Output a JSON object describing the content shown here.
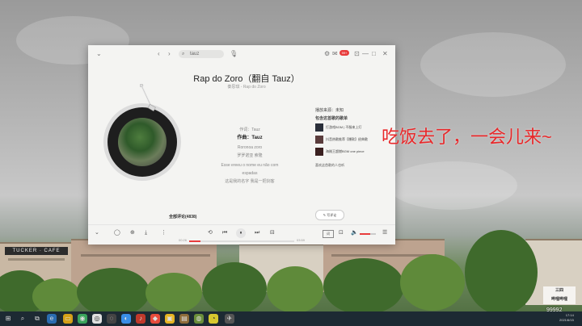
{
  "search": {
    "query": "tauz",
    "icon": "search-icon"
  },
  "topbar": {
    "back": "‹",
    "forward": "›",
    "mic": "🎙",
    "badge": "99+",
    "minimize": "—",
    "maximize": "□",
    "close": "✕",
    "collapse": "⌄"
  },
  "song": {
    "title": "Rap do Zoro（翻自 Tauz）",
    "subtitle": "秦思琪 - Rap do Zoro"
  },
  "lyrics": [
    {
      "text": "作词：Tauz",
      "current": false
    },
    {
      "text": "作曲：Tauz",
      "current": true
    },
    {
      "text": "Roronoa zoro",
      "current": false
    },
    {
      "text": "罗罗诺亚 索隆",
      "current": false
    },
    {
      "text": "Esse ereeu o nome eu não com",
      "current": false
    },
    {
      "text": "espadas",
      "current": false
    },
    {
      "text": "这是我的名字 我是一把剑客",
      "current": false
    }
  ],
  "comments": {
    "label": "全部评论(4838)"
  },
  "side": {
    "source_label": "播放来源：未知",
    "section_title": "包含这首歌的歌单",
    "playlists": [
      {
        "title": "打游戏BGM | 不服来上灯"
      },
      {
        "title": "抖音热歌推荐【爆款】经典歌"
      },
      {
        "title": "海贼王超燃BGM one piece"
      }
    ],
    "more": "喜欢这首歌的人也听",
    "write_comment": "✎ 写评论"
  },
  "controls": {
    "collapse": "⌄",
    "comment": "◯",
    "add": "⊕",
    "download": "⤓",
    "more": "⋮",
    "loop": "⟲",
    "prev": "⏮",
    "play": "⏸",
    "next": "⏭",
    "danmu": "⊟",
    "time_elapsed": "00:26",
    "time_total": "03:59",
    "progress": 0.11,
    "lyric_btn": "词",
    "devices": "⊡",
    "volume_icon": "🔈",
    "volume": 0.65,
    "playlist": "☰"
  },
  "overlay": {
    "text": "吃饭去了，一会儿来~"
  },
  "watermark": {
    "line1": "三四",
    "line2": "哔哩哔哩"
  },
  "counter": "99992",
  "clock": {
    "time": "17:14",
    "date": "2021/6/15"
  },
  "colors": {
    "accent": "#e83c3c",
    "overlay": "#e8282a",
    "taskbar": "#1d2a33"
  }
}
